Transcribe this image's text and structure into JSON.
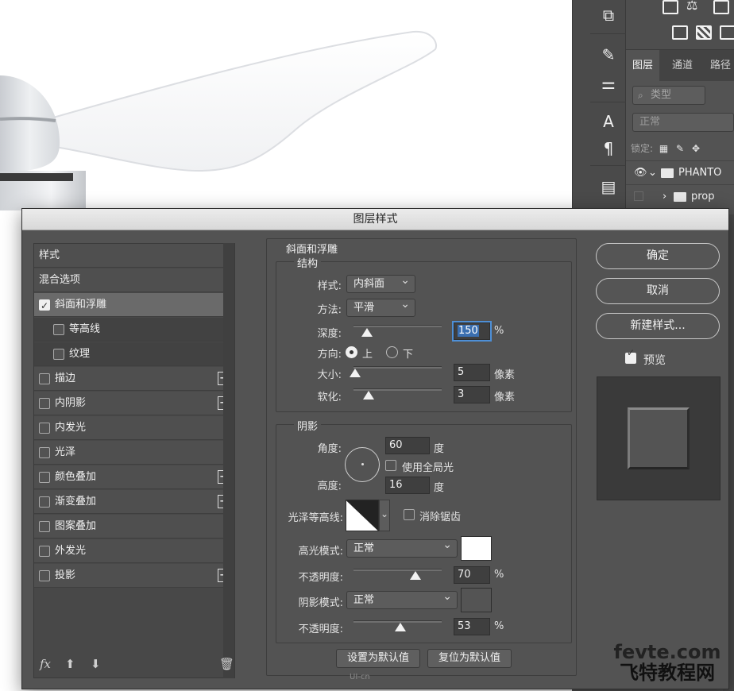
{
  "dialog": {
    "title": "图层样式",
    "footer_watermark": "UI-cn"
  },
  "style_list": {
    "items": [
      {
        "label": "样式",
        "checkbox": false,
        "checked": false,
        "plus": false
      },
      {
        "label": "混合选项",
        "checkbox": false,
        "checked": false,
        "plus": false
      },
      {
        "label": "斜面和浮雕",
        "checkbox": true,
        "checked": true,
        "plus": false,
        "active": true
      },
      {
        "label": "等高线",
        "checkbox": true,
        "checked": false,
        "plus": false,
        "sub": true
      },
      {
        "label": "纹理",
        "checkbox": true,
        "checked": false,
        "plus": false,
        "sub": true
      },
      {
        "label": "描边",
        "checkbox": true,
        "checked": false,
        "plus": true
      },
      {
        "label": "内阴影",
        "checkbox": true,
        "checked": false,
        "plus": true
      },
      {
        "label": "内发光",
        "checkbox": true,
        "checked": false,
        "plus": false
      },
      {
        "label": "光泽",
        "checkbox": true,
        "checked": false,
        "plus": false
      },
      {
        "label": "颜色叠加",
        "checkbox": true,
        "checked": false,
        "plus": true
      },
      {
        "label": "渐变叠加",
        "checkbox": true,
        "checked": false,
        "plus": true
      },
      {
        "label": "图案叠加",
        "checkbox": true,
        "checked": false,
        "plus": false
      },
      {
        "label": "外发光",
        "checkbox": true,
        "checked": false,
        "plus": false
      },
      {
        "label": "投影",
        "checkbox": true,
        "checked": false,
        "plus": true
      }
    ],
    "footer": {
      "fx": "fx",
      "up": "⬆",
      "down": "⬇",
      "trash": "🗑"
    }
  },
  "bevel": {
    "section_title": "斜面和浮雕",
    "structure": {
      "title": "结构",
      "style_label": "样式:",
      "style_value": "内斜面",
      "technique_label": "方法:",
      "technique_value": "平滑",
      "depth_label": "深度:",
      "depth_value": "150",
      "depth_unit": "%",
      "depth_slider": 0.15,
      "direction_label": "方向:",
      "direction_up": "上",
      "direction_down": "下",
      "direction_selected": "上",
      "size_label": "大小:",
      "size_value": "5",
      "size_unit": "像素",
      "size_slider": 0.02,
      "soften_label": "软化:",
      "soften_value": "3",
      "soften_unit": "像素",
      "soften_slider": 0.17
    },
    "shading": {
      "title": "阴影",
      "angle_label": "角度:",
      "angle_value": "60",
      "angle_unit": "度",
      "global_light_label": "使用全局光",
      "global_light_checked": false,
      "altitude_label": "高度:",
      "altitude_value": "16",
      "altitude_unit": "度",
      "gloss_contour_label": "光泽等高线:",
      "anti_alias_label": "消除锯齿",
      "anti_alias_checked": false,
      "highlight_mode_label": "高光模式:",
      "highlight_mode_value": "正常",
      "highlight_color": "#ffffff",
      "highlight_opacity_label": "不透明度:",
      "highlight_opacity_value": "70",
      "highlight_opacity_unit": "%",
      "highlight_opacity_slider": 0.7,
      "shadow_mode_label": "阴影模式:",
      "shadow_mode_value": "正常",
      "shadow_color": "#545454",
      "shadow_opacity_label": "不透明度:",
      "shadow_opacity_value": "53",
      "shadow_opacity_unit": "%",
      "shadow_opacity_slider": 0.53
    },
    "make_default": "设置为默认值",
    "reset_default": "复位为默认值"
  },
  "actions": {
    "ok": "确定",
    "cancel": "取消",
    "new_style": "新建样式...",
    "preview_label": "预览",
    "preview_checked": true
  },
  "layers_panel": {
    "tabs": [
      "图层",
      "通道",
      "路径"
    ],
    "kind_filter": "类型",
    "blend_mode": "正常",
    "lock_label": "锁定:",
    "layers": [
      {
        "name": "PHANTO"
      },
      {
        "name": "prop"
      }
    ]
  },
  "watermark": {
    "line1": "fevte.com",
    "line2": "飞特教程网"
  }
}
